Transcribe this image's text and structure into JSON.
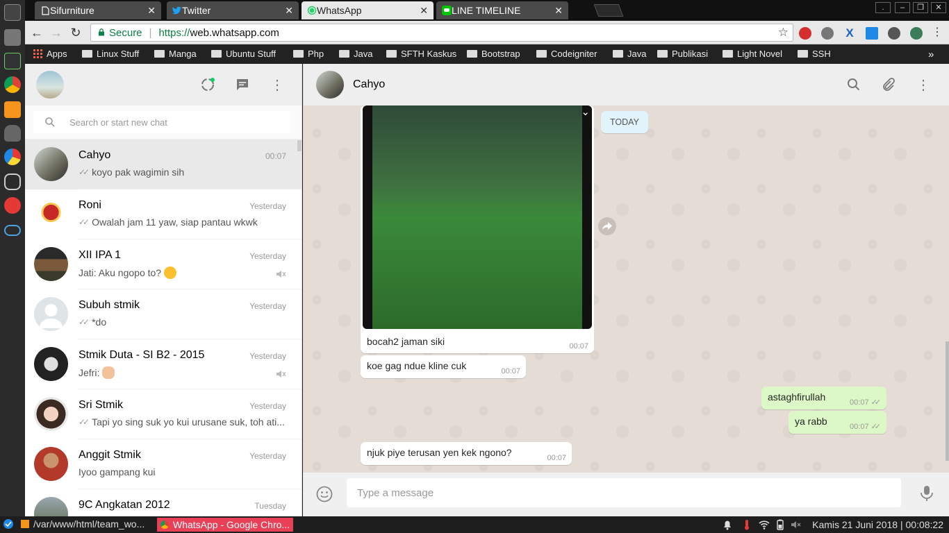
{
  "browser": {
    "tabs": [
      {
        "title": "Sifurniture",
        "active": false
      },
      {
        "title": "Twitter",
        "active": false
      },
      {
        "title": "WhatsApp",
        "active": true
      },
      {
        "title": "LINE TIMELINE",
        "active": false
      }
    ],
    "url": {
      "secure_label": "Secure",
      "scheme": "https://",
      "host": "web.whatsapp.com"
    },
    "bookmarks": [
      "Apps",
      "Linux Stuff",
      "Manga",
      "Ubuntu Stuff",
      "Php",
      "Java",
      "SFTH Kaskus",
      "Bootstrap",
      "Codeigniter",
      "Java",
      "Publikasi",
      "Light Novel",
      "SSH"
    ],
    "bookmarks_more": "»"
  },
  "whatsapp": {
    "search_placeholder": "Search or start new chat",
    "chats": [
      {
        "name": "Cahyo",
        "time": "00:07",
        "preview": "koyo pak wagimin sih",
        "ticks": true,
        "muted": false,
        "selected": true
      },
      {
        "name": "Roni",
        "time": "Yesterday",
        "preview": "Owalah jam 11 yaw, siap pantau wkwk",
        "ticks": true,
        "muted": false
      },
      {
        "name": "XII IPA 1",
        "time": "Yesterday",
        "preview": "Jati: Aku ngopo to?",
        "emoji": "thinking-face",
        "muted": true
      },
      {
        "name": "Subuh stmik",
        "time": "Yesterday",
        "preview": "*do",
        "ticks": true,
        "muted": false
      },
      {
        "name": "Stmik Duta - SI B2 - 2015",
        "time": "Yesterday",
        "preview": "Jefri:",
        "emoji": "ok-hand",
        "muted": true
      },
      {
        "name": "Sri Stmik",
        "time": "Yesterday",
        "preview": "Tapi yo sing suk yo kui urusane suk, toh ati...",
        "ticks": true,
        "muted": false
      },
      {
        "name": "Anggit Stmik",
        "time": "Yesterday",
        "preview": "Iyoo gampang kui",
        "muted": false
      },
      {
        "name": "9C Angkatan 2012",
        "time": "Tuesday",
        "preview": "",
        "muted": false
      }
    ],
    "conversation": {
      "contact": "Cahyo",
      "day_label": "TODAY",
      "messages": [
        {
          "dir": "in",
          "type": "image",
          "caption": "bocah2 jaman siki",
          "time": "00:07"
        },
        {
          "dir": "in",
          "text": "koe gag ndue kline cuk",
          "time": "00:07"
        },
        {
          "dir": "out",
          "text": "astaghfirullah",
          "time": "00:07"
        },
        {
          "dir": "out",
          "text": "ya rabb",
          "time": "00:07"
        },
        {
          "dir": "in",
          "text": "njuk piye terusan yen kek ngono?",
          "time": "00:07"
        }
      ],
      "compose_placeholder": "Type a message"
    }
  },
  "taskbar": {
    "items": [
      "/var/www/html/team_wo...",
      "WhatsApp - Google Chro..."
    ],
    "clock": "Kamis 21 Juni 2018 | 00:08:22"
  },
  "colors": {
    "accent_green": "#0b8043",
    "out_bubble": "#dcf8c6",
    "chat_bg": "#e5ddd5",
    "taskbar_active": "#e84057"
  }
}
